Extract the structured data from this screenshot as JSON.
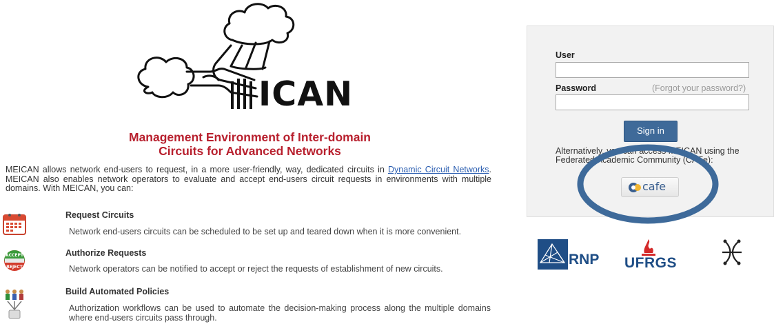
{
  "logo": {
    "wordmark": "ICAN"
  },
  "tagline": {
    "line1": "Management Environment of Inter-domain",
    "line2": "Circuits for Advanced Networks"
  },
  "intro": {
    "text_before_link": "MEICAN allows network end-users to request, in a more user-friendly, way, dedicated circuits in ",
    "link_text": "Dynamic Circuit Networks",
    "text_after_link": ". MEICAN also enables network operators to evaluate and accept end-users circuit requests in environments with multiple domains. With MEICAN, you can:"
  },
  "features": [
    {
      "title": "Request Circuits",
      "description": "Network end-users circuits can be scheduled to be set up and teared down when it is more convenient.",
      "icon": "calendar-icon"
    },
    {
      "title": "Authorize Requests",
      "description": "Network operators can be notified to accept or reject the requests of establishment of new circuits.",
      "icon": "accept-reject-icon"
    },
    {
      "title": "Build Automated Policies",
      "description": "Authorization workflows can be used to automate the decision-making process along the multiple domains where end-users circuits pass through.",
      "icon": "workflow-users-icon"
    }
  ],
  "login": {
    "user_label": "User",
    "user_value": "",
    "password_label": "Password",
    "password_value": "",
    "forgot_link": "(Forgot your password?)",
    "signin_label": "Sign in",
    "alternative_text": "Alternatively, you can access MEICAN using the Federated Academic Community (CAFe):",
    "cafe_label": "cafe"
  },
  "partners": [
    {
      "name": "RNP",
      "icon": "rnp-logo-icon"
    },
    {
      "name": "UFRGS",
      "icon": "ufrgs-logo-icon"
    },
    {
      "name": "",
      "icon": "network-nodes-logo-icon"
    }
  ],
  "colors": {
    "tagline_red": "#b8202e",
    "link_blue": "#2a5db0",
    "signin_blue": "#3f6a99",
    "highlight_ring": "#3e6a9a",
    "partner_blue": "#1f4e86"
  }
}
